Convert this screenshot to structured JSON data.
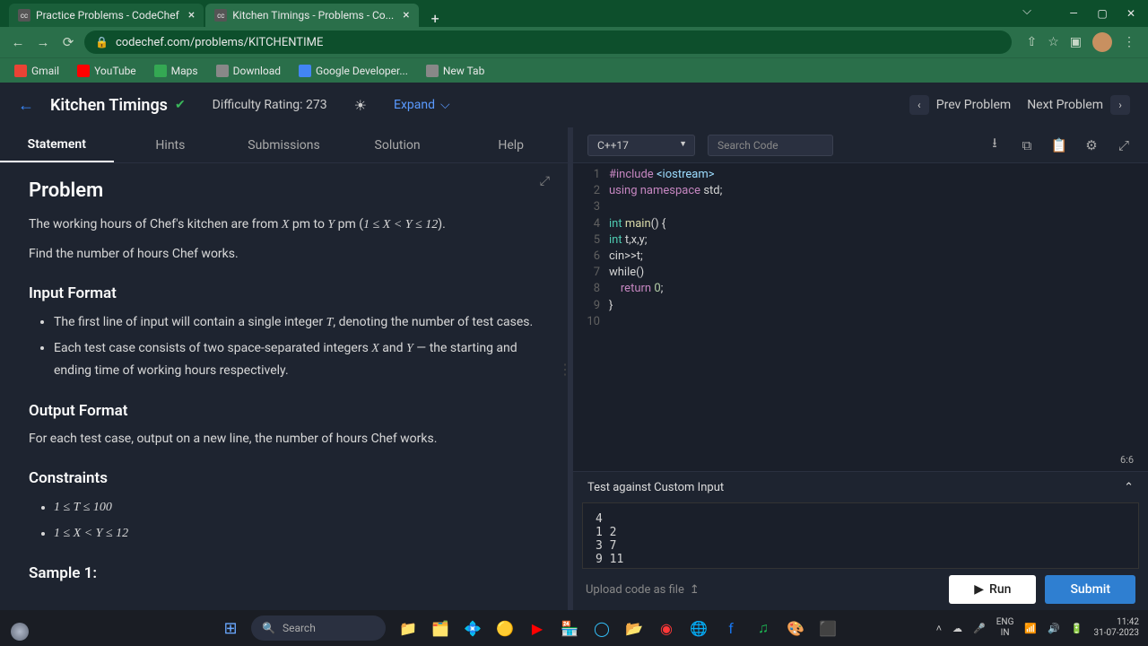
{
  "browser": {
    "tabs": [
      {
        "label": "Practice Problems - CodeChef",
        "active": false
      },
      {
        "label": "Kitchen Timings - Problems - Co...",
        "active": true
      }
    ],
    "url": "codechef.com/problems/KITCHENTIME",
    "bookmarks": [
      {
        "label": "Gmail",
        "color": "#ea4335"
      },
      {
        "label": "YouTube",
        "color": "#ff0000"
      },
      {
        "label": "Maps",
        "color": "#34a853"
      },
      {
        "label": "Download",
        "color": "#888"
      },
      {
        "label": "Google Developer...",
        "color": "#4285f4"
      },
      {
        "label": "New Tab",
        "color": "#888"
      }
    ]
  },
  "page": {
    "title": "Kitchen Timings",
    "difficulty": "Difficulty Rating: 273",
    "expand": "Expand",
    "prev": "Prev Problem",
    "next": "Next Problem",
    "tabs": [
      "Statement",
      "Hints",
      "Submissions",
      "Solution",
      "Help"
    ],
    "active_tab": "Statement"
  },
  "problem": {
    "heading": "Problem",
    "body1_a": "The working hours of Chef's kitchen are from ",
    "body1_b": " pm to ",
    "body1_c": " pm (",
    "body1_d": ").",
    "math1": "1 ≤ X < Y ≤ 12",
    "body2": "Find the number of hours Chef works.",
    "input_h": "Input Format",
    "input_l1_a": "The first line of input will contain a single integer ",
    "input_l1_b": ", denoting the number of test cases.",
    "input_l2_a": "Each test case consists of two space-separated integers ",
    "input_l2_b": " and ",
    "input_l2_c": " — the starting and ending time of working hours respectively.",
    "output_h": "Output Format",
    "output_b": "For each test case, output on a new line, the number of hours Chef works.",
    "constraints_h": "Constraints",
    "constraints": [
      "1 ≤ T ≤ 100",
      "1 ≤ X < Y ≤ 12"
    ],
    "sample_h": "Sample 1:"
  },
  "editor": {
    "language": "C++17",
    "search_placeholder": "Search Code",
    "cursor": "6:6",
    "lines": [
      "1",
      "2",
      "3",
      "4",
      "5",
      "6",
      "7",
      "8",
      "9",
      "10"
    ],
    "code": {
      "l1a": "#include ",
      "l1b": "<iostream>",
      "l2a": "using ",
      "l2b": "namespace ",
      "l2c": "std;",
      "l4a": "int ",
      "l4b": "main",
      "l4c": "() {",
      "l5a": "int ",
      "l5b": "t,x,y;",
      "l6a": "cin>>t;",
      "l7a": "while()",
      "l8a": "    return ",
      "l8b": "0",
      "l8c": ";",
      "l9a": "}"
    }
  },
  "io": {
    "header": "Test against Custom Input",
    "input": "4\n1 2\n3 7\n9 11",
    "upload": "Upload code as file",
    "run": "Run",
    "submit": "Submit"
  },
  "taskbar": {
    "search": "Search",
    "lang_top": "ENG",
    "lang_bot": "IN",
    "time": "11:42",
    "date": "31-07-2023"
  }
}
